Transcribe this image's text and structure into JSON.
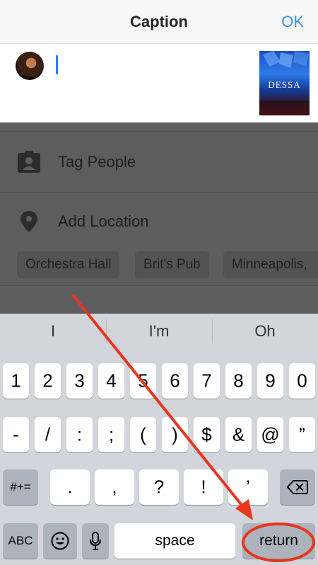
{
  "nav": {
    "title": "Caption",
    "ok_label": "OK"
  },
  "compose": {
    "caption_value": "",
    "thumbnail_text": "DESSA"
  },
  "options": {
    "tag_people": "Tag People",
    "add_location": "Add Location",
    "location_suggestions": [
      "Orchestra Hall",
      "Brit's Pub",
      "Minneapolis,"
    ]
  },
  "keyboard": {
    "suggestions": [
      "I",
      "I'm",
      "Oh"
    ],
    "row1": [
      "1",
      "2",
      "3",
      "4",
      "5",
      "6",
      "7",
      "8",
      "9",
      "0"
    ],
    "row2": [
      "-",
      "/",
      ":",
      ";",
      "(",
      ")",
      "$",
      "&",
      "@",
      "”"
    ],
    "row3_left": "#+=",
    "row3": [
      ".",
      ",",
      "?",
      "!",
      "’"
    ],
    "abc": "ABC",
    "space": "space",
    "return": "return"
  },
  "colors": {
    "accent": "#3897f0",
    "annotation": "#e8341c"
  },
  "icons": [
    "tag-person-icon",
    "location-pin-icon",
    "backspace-icon",
    "emoji-icon",
    "microphone-icon"
  ]
}
